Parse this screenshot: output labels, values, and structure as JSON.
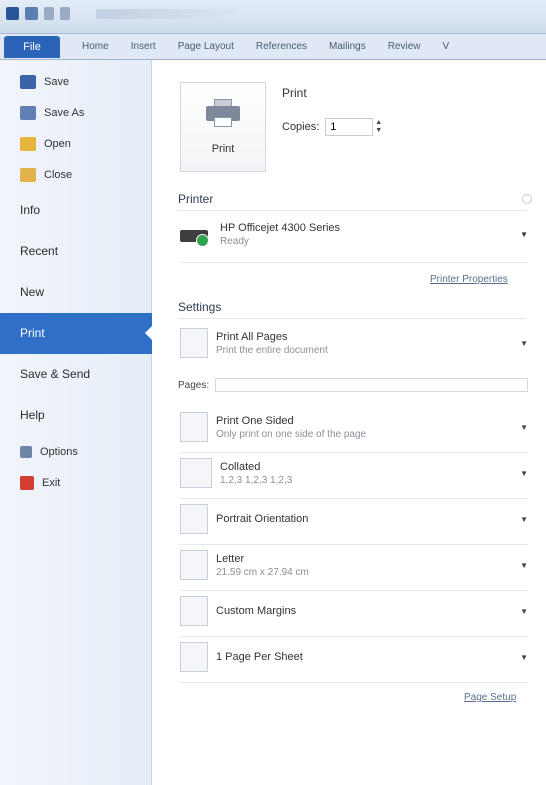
{
  "ribbon": {
    "file_tab": "File",
    "tabs": [
      "Home",
      "Insert",
      "Page Layout",
      "References",
      "Mailings",
      "Review",
      "V"
    ]
  },
  "nav": {
    "save": "Save",
    "save_as": "Save As",
    "open": "Open",
    "close": "Close",
    "info": "Info",
    "recent": "Recent",
    "new": "New",
    "print": "Print",
    "save_send": "Save & Send",
    "help": "Help",
    "options": "Options",
    "exit": "Exit"
  },
  "print": {
    "button_label": "Print",
    "title": "Print",
    "copies_label": "Copies:",
    "copies_value": "1"
  },
  "printer": {
    "heading": "Printer",
    "name": "HP Officejet 4300 Series",
    "status": "Ready",
    "properties_link": "Printer Properties"
  },
  "settings": {
    "heading": "Settings",
    "pages_label": "Pages:",
    "page_setup_link": "Page Setup",
    "items": [
      {
        "title": "Print All Pages",
        "subtitle": "Print the entire document"
      },
      {
        "title": "Print One Sided",
        "subtitle": "Only print on one side of the page"
      },
      {
        "title": "Collated",
        "subtitle": "1,2,3   1,2,3   1,2,3"
      },
      {
        "title": "Portrait Orientation",
        "subtitle": ""
      },
      {
        "title": "Letter",
        "subtitle": "21.59 cm x 27.94 cm"
      },
      {
        "title": "Custom Margins",
        "subtitle": ""
      },
      {
        "title": "1 Page Per Sheet",
        "subtitle": ""
      }
    ]
  }
}
